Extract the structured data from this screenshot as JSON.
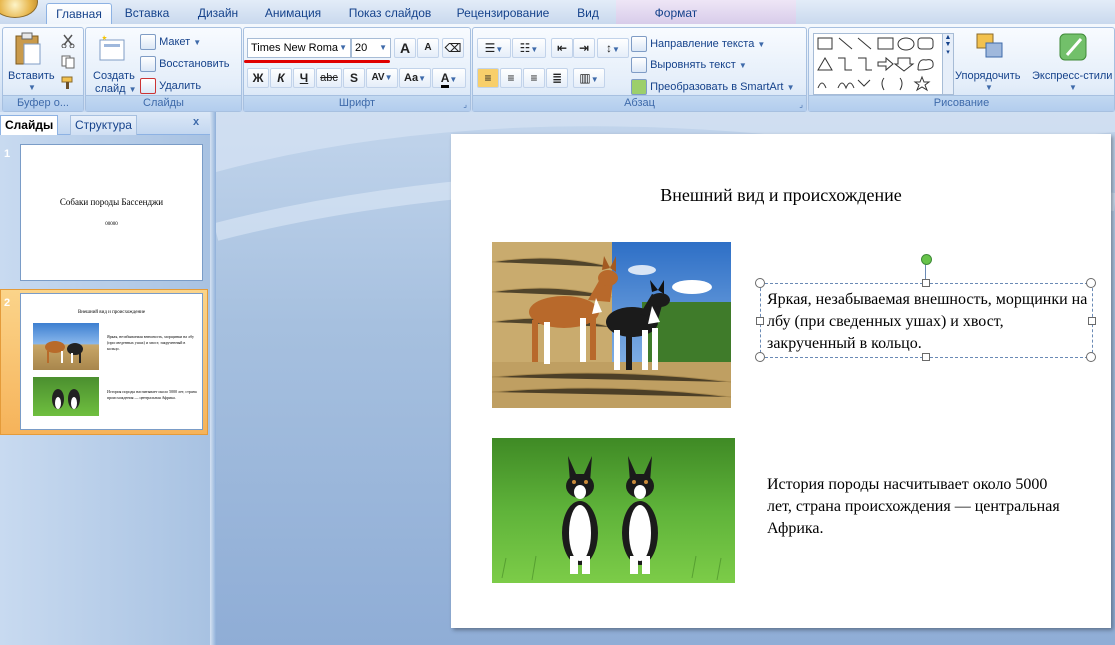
{
  "tabs": [
    "Главная",
    "Вставка",
    "Дизайн",
    "Анимация",
    "Показ слайдов",
    "Рецензирование",
    "Вид",
    "Формат"
  ],
  "ribbon": {
    "clipboard": {
      "paste": "Вставить",
      "label": "Буфер о..."
    },
    "slides": {
      "new_slide": "Создать",
      "new_slide2": "слайд",
      "layout": "Макет",
      "reset": "Восстановить",
      "delete": "Удалить",
      "label": "Слайды"
    },
    "font": {
      "family": "Times New Roma",
      "size": "20",
      "bold": "Ж",
      "italic": "К",
      "underline": "Ч",
      "strike": "abc",
      "shadow": "S",
      "spacing": "AV",
      "case": "Aa",
      "color": "A",
      "grow": "A",
      "shrink": "A",
      "label": "Шрифт"
    },
    "paragraph": {
      "text_direction": "Направление текста",
      "align_text": "Выровнять текст",
      "smartart": "Преобразовать в SmartArt",
      "label": "Абзац"
    },
    "drawing": {
      "arrange": "Упорядочить",
      "quick_styles": "Экспресс-стили",
      "label": "Рисование"
    }
  },
  "left_pane": {
    "tab_slides": "Слайды",
    "tab_outline": "Структура",
    "close": "x",
    "slides": [
      {
        "num": "1",
        "title": "Собаки породы Бассенджи",
        "subtitle": "00000"
      },
      {
        "num": "2",
        "title": "Внешний вид и происхождение",
        "text1": "Яркая, незабываемая внешность, морщинки на лбу (при сведенных ушах) и хвост, закрученный в кольцо.",
        "text2": "История породы насчитывает около 5000 лет, страна происхождения — центральная Африка."
      }
    ]
  },
  "slide": {
    "title": "Внешний вид и происхождение",
    "text1": "Яркая, незабываемая внешность, морщинки на лбу (при сведенных ушах) и хвост, закрученный в кольцо.",
    "text2": "История породы  насчитывает около 5000 лет, страна происхождения — центральная Африка."
  },
  "colors": {
    "accent": "#15428b",
    "underline": "#e00000",
    "active_slide": "#f6b35a"
  }
}
